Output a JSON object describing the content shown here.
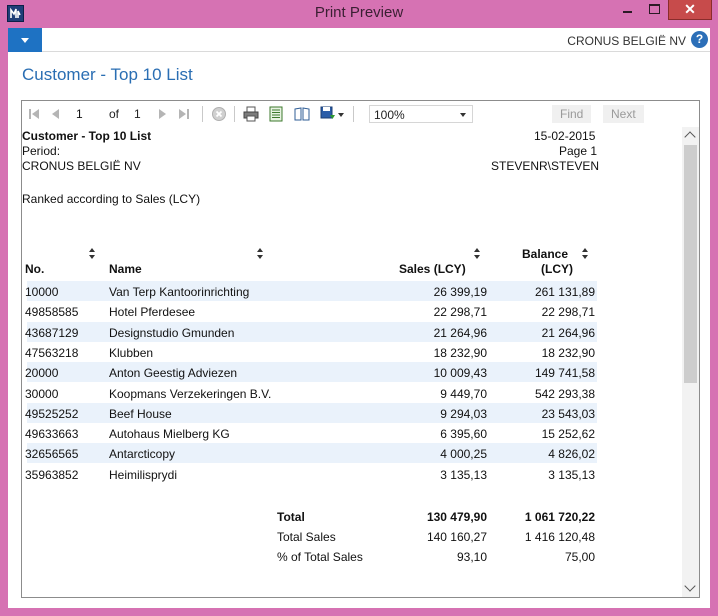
{
  "window": {
    "title": "Print Preview",
    "close_label": "✕"
  },
  "menubar": {
    "company": "CRONUS BELGIË NV",
    "help": "?"
  },
  "page": {
    "title": "Customer - Top 10 List"
  },
  "toolbar": {
    "page_value": "1",
    "of_label": "of",
    "total_pages": "1",
    "zoom": "100%",
    "find_label": "Find",
    "next_label": "Next"
  },
  "report": {
    "title": "Customer - Top 10 List",
    "date": "15-02-2015",
    "period_label": "Period:",
    "page_label": "Page 1",
    "company": "CRONUS BELGIË NV",
    "user": "STEVENR\\STEVEN",
    "ranking_note": "Ranked according to Sales (LCY)",
    "columns": {
      "no": "No.",
      "name": "Name",
      "sales": "Sales (LCY)",
      "balance_line1": "Balance",
      "balance_line2": "(LCY)"
    },
    "rows": [
      {
        "no": "10000",
        "name": "Van Terp Kantoorinrichting",
        "sales": "26 399,19",
        "balance": "261 131,89"
      },
      {
        "no": "49858585",
        "name": "Hotel Pferdesee",
        "sales": "22 298,71",
        "balance": "22 298,71"
      },
      {
        "no": "43687129",
        "name": "Designstudio Gmunden",
        "sales": "21 264,96",
        "balance": "21 264,96"
      },
      {
        "no": "47563218",
        "name": "Klubben",
        "sales": "18 232,90",
        "balance": "18 232,90"
      },
      {
        "no": "20000",
        "name": "Anton Geestig Adviezen",
        "sales": "10 009,43",
        "balance": "149 741,58"
      },
      {
        "no": "30000",
        "name": "Koopmans Verzekeringen B.V.",
        "sales": "9 449,70",
        "balance": "542 293,38"
      },
      {
        "no": "49525252",
        "name": "Beef House",
        "sales": "9 294,03",
        "balance": "23 543,03"
      },
      {
        "no": "49633663",
        "name": "Autohaus Mielberg KG",
        "sales": "6 395,60",
        "balance": "15 252,62"
      },
      {
        "no": "32656565",
        "name": "Antarcticopy",
        "sales": "4 000,25",
        "balance": "4 826,02"
      },
      {
        "no": "35963852",
        "name": "Heimilisprydi",
        "sales": "3 135,13",
        "balance": "3 135,13"
      }
    ],
    "totals": [
      {
        "label": "Total",
        "sales": "130 479,90",
        "balance": "1 061 720,22",
        "bold": true
      },
      {
        "label": "Total Sales",
        "sales": "140 160,27",
        "balance": "1 416 120,48",
        "bold": false
      },
      {
        "label": "% of Total Sales",
        "sales": "93,10",
        "balance": "75,00",
        "bold": false
      }
    ]
  },
  "colors": {
    "frame": "#d672b3",
    "accent": "#1e72c3",
    "title_blue": "#2a6eb3",
    "row_stripe": "#eaf2fb"
  },
  "icons": [
    "app-logo-icon",
    "first-page-icon",
    "previous-page-icon",
    "next-page-icon",
    "last-page-icon",
    "stop-icon",
    "print-icon",
    "page-setup-icon",
    "print-layout-icon",
    "export-icon",
    "help-icon"
  ]
}
